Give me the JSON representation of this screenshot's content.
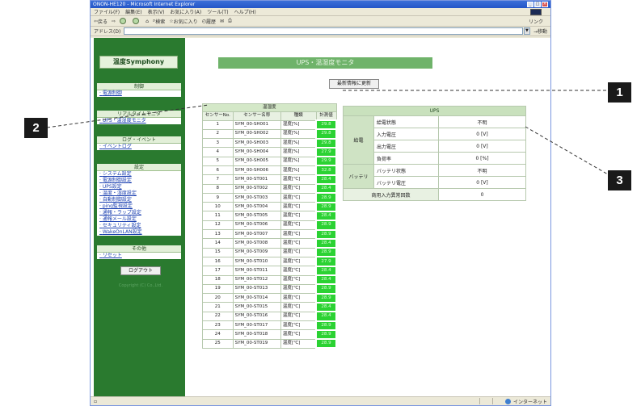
{
  "browser": {
    "title": "ONON-HE120 - Microsoft Internet Explorer",
    "menu": [
      "ファイル(F)",
      "編集(E)",
      "表示(V)",
      "お気に入り(A)",
      "ツール(T)",
      "ヘルプ(H)"
    ],
    "toolbar": {
      "back": "戻る",
      "search": "検索",
      "favorites": "お気に入り",
      "history": "履歴",
      "links": "リンク"
    },
    "address_label": "アドレス(D)",
    "go_label": "移動",
    "status_zone": "インターネット"
  },
  "sidebar": {
    "brand": "温度Symphony",
    "sections": [
      {
        "header": "制御",
        "items": [
          "電源制御"
        ]
      },
      {
        "header": "リアルタイムモニタ",
        "items": [
          "UPS・温湿度モニタ"
        ]
      },
      {
        "header": "ログ・イベント",
        "items": [
          "イベントログ"
        ]
      },
      {
        "header": "設定",
        "items": [
          "システム設定",
          "電源制御設定",
          "UPS設定",
          "温度・湿度設定",
          "自動制御設定",
          "ping監視設定",
          "通報・ラップ設定",
          "通報メール設定",
          "セキュリティ設定",
          "WakeOnLAN設定"
        ]
      },
      {
        "header": "その他",
        "items": [
          "リセット"
        ]
      }
    ],
    "logout": "ログアウト",
    "copyright": "Copyright (C) Co.,Ltd."
  },
  "main": {
    "title": "UPS・温湿度モニタ",
    "refresh_button": "最新情報に更新",
    "sensor_table": {
      "caption": "温湿度",
      "headers": [
        "センサーNo.",
        "センサー名称",
        "種類",
        "計測値"
      ],
      "rows": [
        [
          "1",
          "SYM_00-SH001",
          "湿度[%]",
          "29.8"
        ],
        [
          "2",
          "SYM_00-SH002",
          "湿度[%]",
          "29.8"
        ],
        [
          "3",
          "SYM_00-SH003",
          "湿度[%]",
          "29.8"
        ],
        [
          "4",
          "SYM_00-SH004",
          "湿度[%]",
          "27.9"
        ],
        [
          "5",
          "SYM_00-SH005",
          "湿度[%]",
          "29.9"
        ],
        [
          "6",
          "SYM_00-SH006",
          "湿度[%]",
          "32.8"
        ],
        [
          "7",
          "SYM_00-ST001",
          "温度[℃]",
          "28.4"
        ],
        [
          "8",
          "SYM_00-ST002",
          "温度[℃]",
          "28.4"
        ],
        [
          "9",
          "SYM_00-ST003",
          "温度[℃]",
          "28.9"
        ],
        [
          "10",
          "SYM_00-ST004",
          "温度[℃]",
          "28.9"
        ],
        [
          "11",
          "SYM_00-ST005",
          "温度[℃]",
          "28.4"
        ],
        [
          "12",
          "SYM_00-ST006",
          "温度[℃]",
          "28.9"
        ],
        [
          "13",
          "SYM_00-ST007",
          "温度[℃]",
          "28.9"
        ],
        [
          "14",
          "SYM_00-ST008",
          "温度[℃]",
          "28.4"
        ],
        [
          "15",
          "SYM_00-ST009",
          "温度[℃]",
          "28.9"
        ],
        [
          "16",
          "SYM_00-ST010",
          "温度[℃]",
          "27.9"
        ],
        [
          "17",
          "SYM_00-ST011",
          "温度[℃]",
          "28.4"
        ],
        [
          "18",
          "SYM_00-ST012",
          "温度[℃]",
          "28.4"
        ],
        [
          "19",
          "SYM_00-ST013",
          "温度[℃]",
          "28.9"
        ],
        [
          "20",
          "SYM_00-ST014",
          "温度[℃]",
          "28.9"
        ],
        [
          "21",
          "SYM_00-ST015",
          "温度[℃]",
          "28.4"
        ],
        [
          "22",
          "SYM_00-ST016",
          "温度[℃]",
          "28.4"
        ],
        [
          "23",
          "SYM_00-ST017",
          "温度[℃]",
          "28.9"
        ],
        [
          "24",
          "SYM_00-ST018",
          "温度[℃]",
          "28.9"
        ],
        [
          "25",
          "SYM_00-ST019",
          "温度[℃]",
          "28.9"
        ]
      ]
    },
    "ups_table": {
      "caption": "UPS",
      "groups": [
        {
          "name": "給電",
          "rows": [
            [
              "給電状態",
              "不明"
            ],
            [
              "入力電圧",
              "0 [V]"
            ],
            [
              "出力電圧",
              "0 [V]"
            ],
            [
              "負荷率",
              "0 [%]"
            ]
          ]
        },
        {
          "name": "バッテリ",
          "rows": [
            [
              "バッテリ状態",
              "不明"
            ],
            [
              "バッテリ電圧",
              "0 [V]"
            ]
          ]
        }
      ],
      "footer": [
        "商用入力異常回数",
        "0"
      ]
    }
  },
  "callouts": [
    "1",
    "2",
    "3"
  ],
  "colors": {
    "sidebar": "#2a7a2f",
    "title_bar": "#6fb36a",
    "value_cell": "#2bd233",
    "callout": "#1a1a1a"
  }
}
